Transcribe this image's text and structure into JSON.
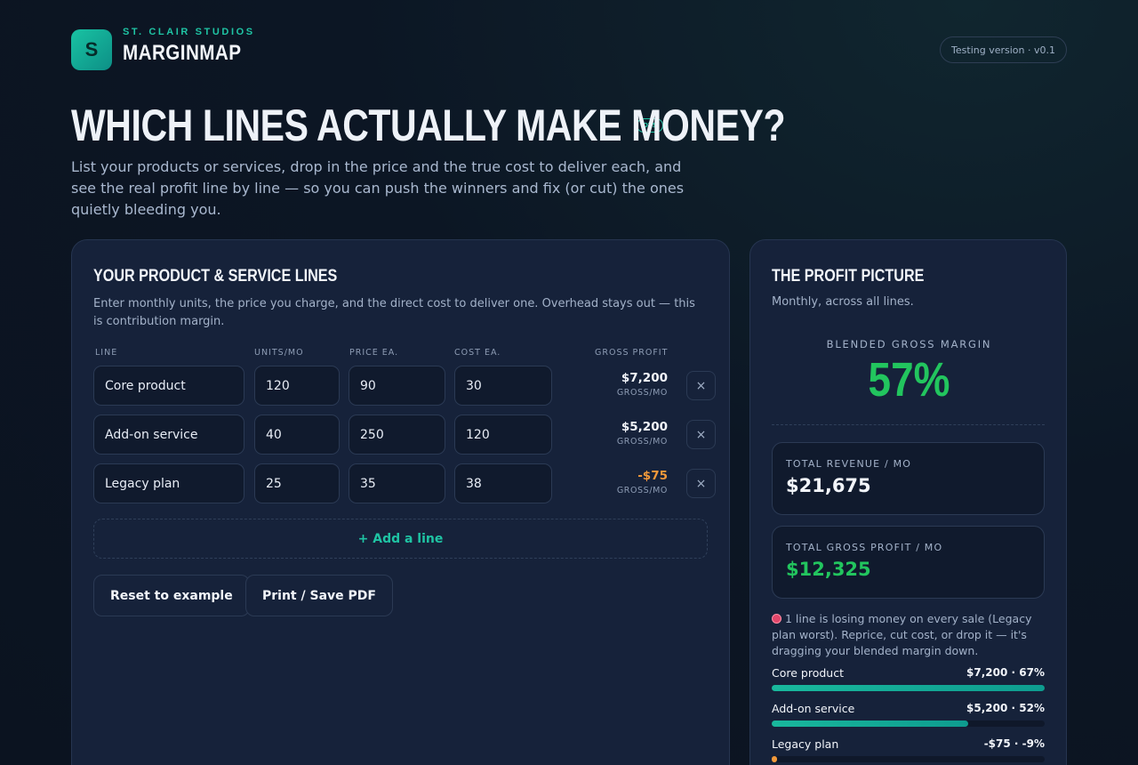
{
  "brand": {
    "logo_letter": "S",
    "studio": "ST. CLAIR STUDIOS",
    "app_name": "MARGINMAP",
    "version": "Testing version · v0.1"
  },
  "hero": {
    "headline": "WHICH LINES ACTUALLY MAKE MONEY?",
    "badge": "OTS",
    "intro": "List your products or services, drop in the price and the true cost to deliver each, and see the real profit line by line — so you can push the winners and fix (or cut) the ones quietly bleeding you."
  },
  "lines_panel": {
    "title": "YOUR PRODUCT & SERVICE LINES",
    "subtitle": "Enter monthly units, the price you charge, and the direct cost to deliver one. Overhead stays out — this is contribution margin.",
    "columns": {
      "line": "LINE",
      "units": "UNITS/MO",
      "price": "PRICE EA.",
      "cost": "COST EA.",
      "profit": "GROSS PROFIT"
    },
    "rows": [
      {
        "name": "Core product",
        "units": "120",
        "price": "90",
        "cost": "30",
        "profit": "$7,200",
        "profit_unit": "GROSS/MO",
        "remove": "×"
      },
      {
        "name": "Add-on service",
        "units": "40",
        "price": "250",
        "cost": "120",
        "profit": "$5,200",
        "profit_unit": "GROSS/MO",
        "remove": "×"
      },
      {
        "name": "Legacy plan",
        "units": "25",
        "price": "35",
        "cost": "38",
        "profit": "-$75",
        "profit_unit": "GROSS/MO",
        "remove": "×"
      }
    ],
    "add_line": "+ Add a line",
    "reset_label": "Reset to example",
    "print_label": "Print / Save PDF"
  },
  "profit_panel": {
    "title": "THE PROFIT PICTURE",
    "subtitle": "Monthly, across all lines.",
    "blended_label": "BLENDED GROSS MARGIN",
    "blended_value": "57%",
    "revenue_label": "TOTAL REVENUE / MO",
    "revenue_value": "$21,675",
    "gross_label": "TOTAL GROSS PROFIT / MO",
    "gross_value": "$12,325",
    "warning": "1 line is losing money on every sale (Legacy plan worst). Reprice, cut cost, or drop it — it's dragging your blended margin down.",
    "bars": [
      {
        "name": "Core product",
        "meta": "$7,200 · 67%",
        "share": 1.0
      },
      {
        "name": "Add-on service",
        "meta": "$5,200 · 52%",
        "share": 0.72
      },
      {
        "name": "Legacy plan",
        "meta": "-$75 · -9%",
        "share": 0.0
      }
    ]
  },
  "colors": {
    "accent": "#1fc4a4",
    "positive": "#22c55e",
    "negative": "#f2993a",
    "warning": "#e2466a"
  }
}
